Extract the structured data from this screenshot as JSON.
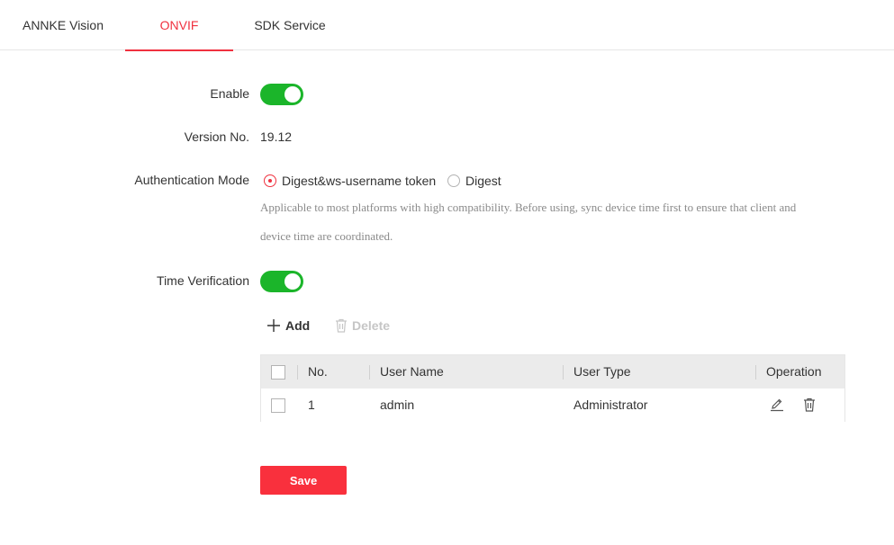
{
  "tabs": [
    {
      "label": "ANNKE Vision"
    },
    {
      "label": "ONVIF",
      "active": true
    },
    {
      "label": "SDK Service"
    }
  ],
  "form": {
    "enable": {
      "label": "Enable",
      "on": true
    },
    "version": {
      "label": "Version No.",
      "value": "19.12"
    },
    "auth_mode": {
      "label": "Authentication Mode",
      "options": [
        {
          "label": "Digest&ws-username token",
          "selected": true
        },
        {
          "label": "Digest",
          "selected": false
        }
      ],
      "hint_line1": "Applicable to most platforms with high compatibility. Before using, sync device time first to ensure that client and",
      "hint_line2": "device time are coordinated."
    },
    "time_verification": {
      "label": "Time Verification",
      "on": true
    }
  },
  "toolbar": {
    "add_label": "Add",
    "delete_label": "Delete"
  },
  "table": {
    "columns": [
      "No.",
      "User Name",
      "User Type",
      "Operation"
    ],
    "rows": [
      {
        "no": "1",
        "user_name": "admin",
        "user_type": "Administrator"
      }
    ]
  },
  "save_label": "Save",
  "colors": {
    "accent": "#f0313f",
    "toggle_on": "#1bb52a",
    "header_bg": "#ebebeb"
  },
  "icons": [
    "plus-icon",
    "trash-icon",
    "edit-icon",
    "delete-icon"
  ]
}
